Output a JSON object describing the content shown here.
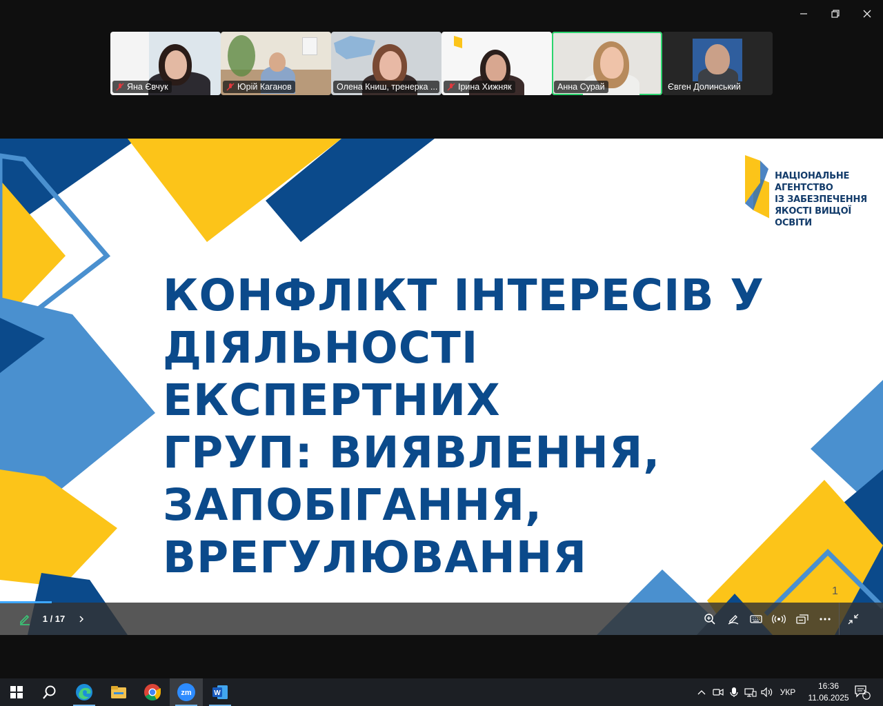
{
  "window": {
    "controls": [
      "minimize",
      "restore",
      "close"
    ]
  },
  "participants": [
    {
      "name": "Яна Євчук",
      "muted": true,
      "active": false
    },
    {
      "name": "Юрій Каганов",
      "muted": true,
      "active": false
    },
    {
      "name": "Олена Книш, тренерка ...",
      "muted": false,
      "active": false
    },
    {
      "name": "Ірина Хижняк",
      "muted": true,
      "active": false
    },
    {
      "name": "Анна Сурай",
      "muted": false,
      "active": true
    },
    {
      "name": "Євген Долинський",
      "muted": false,
      "active": false
    }
  ],
  "slide": {
    "title": "КОНФЛІКТ ІНТЕРЕСІВ У ДІЯЛЬНОСТІ ЕКСПЕРТНИХ ГРУП: ВИЯВЛЕННЯ, ЗАПОБІГАННЯ, ВРЕГУЛЮВАННЯ",
    "title_lines": [
      "КОНФЛІКТ ІНТЕРЕСІВ У",
      "ДІЯЛЬНОСТІ ЕКСПЕРТНИХ",
      "ГРУП: ВИЯВЛЕННЯ,",
      "ЗАПОБІГАННЯ,",
      "ВРЕГУЛЮВАННЯ"
    ],
    "logo_lines": [
      "НАЦІОНАЛЬНЕ",
      "АГЕНТСТВО",
      "ІЗ ЗАБЕЗПЕЧЕННЯ",
      "ЯКОСТІ ВИЩОЇ ОСВІТИ"
    ],
    "page_number": "1",
    "colors": {
      "blue_dark": "#0b4a8b",
      "blue_light": "#4a90cf",
      "yellow": "#fcc419"
    }
  },
  "presentation_bar": {
    "page_indicator": "1 / 17",
    "current_page": 1,
    "total_pages": 17,
    "progress_fraction": 0.0588,
    "icons": [
      "annotate-pencil-icon",
      "next-chevron-icon",
      "zoom-in-icon",
      "pen-icon",
      "keyboard-icon",
      "broadcast-icon",
      "windows-icon",
      "more-icon",
      "exit-fullscreen-icon"
    ]
  },
  "taskbar": {
    "apps": [
      "windows-start-icon",
      "search-icon",
      "edge-icon",
      "file-explorer-icon",
      "chrome-icon",
      "zoom-icon",
      "word-icon"
    ],
    "language": "УКР",
    "time": "16:36",
    "date": "11.06.2025",
    "notifications_count": "1"
  }
}
